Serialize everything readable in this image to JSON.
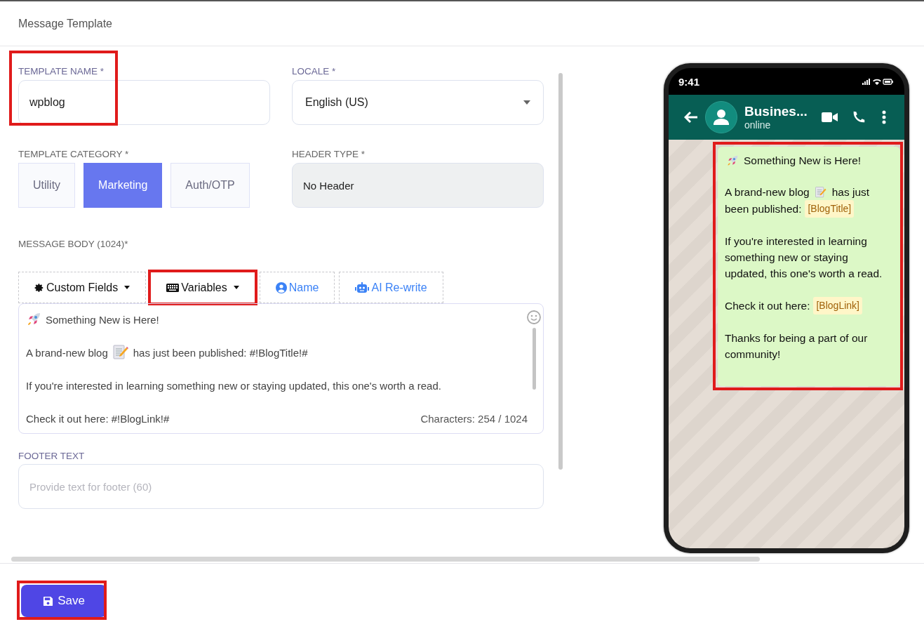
{
  "page_title": "Message Template",
  "template_name": {
    "label": "TEMPLATE NAME *",
    "value": "wpblog",
    "highlighted": true
  },
  "locale": {
    "label": "LOCALE *",
    "value": "English (US)"
  },
  "category": {
    "label": "TEMPLATE CATEGORY *",
    "options": [
      {
        "label": "Utility",
        "selected": false
      },
      {
        "label": "Marketing",
        "selected": true
      },
      {
        "label": "Auth/OTP",
        "selected": false
      }
    ]
  },
  "header_type": {
    "label": "HEADER TYPE *",
    "value": "No Header"
  },
  "message_body": {
    "label": "MESSAGE BODY (1024)*",
    "toolbar": [
      {
        "kind": "fields",
        "label": "Custom Fields",
        "highlighted": false
      },
      {
        "kind": "variables",
        "label": "Variables",
        "highlighted": true
      },
      {
        "kind": "name",
        "label": "Name",
        "highlighted": false
      },
      {
        "kind": "ai",
        "label": "AI Re-write",
        "highlighted": false
      }
    ],
    "lines": [
      {
        "parts": [
          {
            "kind": "icon"
          },
          {
            "kind": "text",
            "text": "Something New is Here!"
          }
        ]
      },
      {
        "parts": [
          {
            "kind": "text",
            "text": "A brand-new blog"
          },
          {
            "kind": "icon"
          },
          {
            "kind": "text",
            "text": "has just been published: #!BlogTitle!#"
          }
        ]
      },
      {
        "parts": [
          {
            "kind": "text",
            "text": "If you're interested in learning something new or staying updated, this one's worth a read."
          }
        ]
      },
      {
        "parts": [
          {
            "kind": "text",
            "text": "Check it out here: #!BlogLink!#"
          }
        ]
      }
    ],
    "counter": "Characters: 254 / 1024"
  },
  "footer": {
    "label": "FOOTER TEXT",
    "placeholder": "Provide text for footer (60)"
  },
  "save_button": {
    "label": "Save",
    "highlighted": true
  },
  "preview": {
    "time": "9:41",
    "contact": "Busines...",
    "status": "online",
    "highlighted": true,
    "paragraphs": [
      {
        "parts": [
          {
            "kind": "icon"
          },
          {
            "kind": "text",
            "text": "Something New is Here!"
          }
        ]
      },
      {
        "parts": [
          {
            "kind": "text",
            "text": "A brand-new blog"
          },
          {
            "kind": "icon"
          },
          {
            "kind": "text",
            "text": "has just"
          },
          {
            "kind": "text",
            "text": "been published:"
          },
          {
            "kind": "chip",
            "text": "[BlogTitle]"
          }
        ]
      },
      {
        "parts": [
          {
            "kind": "text",
            "text": "If you're interested in learning something new or staying updated, this one's worth a read."
          }
        ]
      },
      {
        "parts": [
          {
            "kind": "text",
            "text": "Check it out here:"
          },
          {
            "kind": "chip",
            "text": "[BlogLink]"
          }
        ]
      },
      {
        "parts": [
          {
            "kind": "text",
            "text": "Thanks for being a part of our community!"
          }
        ]
      }
    ]
  }
}
